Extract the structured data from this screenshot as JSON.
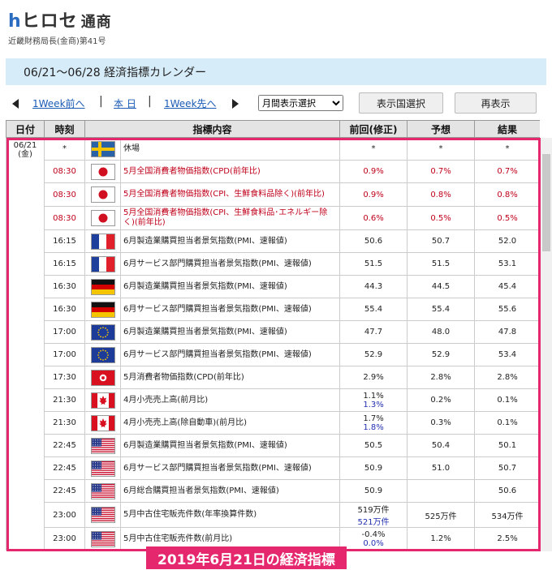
{
  "logo": {
    "brand_h": "h",
    "brand_rest": "ヒロセ",
    "brand_sub": "通商",
    "registration": "近畿財務局長(金商)第41号"
  },
  "title": "06/21～06/28 経済指標カレンダー",
  "nav": {
    "prev_week": "1Week前へ",
    "today": "本 日",
    "next_week": "1Week先へ",
    "view_select": "月間表示選択",
    "country_button": "表示国選択",
    "refresh_button": "再表示"
  },
  "table": {
    "headers": {
      "date": "日付",
      "time": "時刻",
      "content": "指標内容",
      "previous": "前回(修正)",
      "forecast": "予想",
      "result": "結果"
    },
    "date_label": "06/21\n(金)",
    "rows": [
      {
        "time": "*",
        "flag": "sweden",
        "name": "休場",
        "prev": "*",
        "prev_rev": "",
        "forecast": "*",
        "result": "*",
        "red": false
      },
      {
        "time": "08:30",
        "flag": "japan",
        "name": "5月全国消費者物価指数(CPD(前年比)",
        "prev": "0.9%",
        "prev_rev": "",
        "forecast": "0.7%",
        "result": "0.7%",
        "red": true
      },
      {
        "time": "08:30",
        "flag": "japan",
        "name": "5月全国消費者物価指数(CPI、生鮮食料品除く)(前年比)",
        "prev": "0.9%",
        "prev_rev": "",
        "forecast": "0.8%",
        "result": "0.8%",
        "red": true
      },
      {
        "time": "08:30",
        "flag": "japan",
        "name": "5月全国消費者物価指数(CPI、生鮮食料品･エネルギー除く)(前年比)",
        "prev": "0.6%",
        "prev_rev": "",
        "forecast": "0.5%",
        "result": "0.5%",
        "red": true
      },
      {
        "time": "16:15",
        "flag": "france",
        "name": "6月製造業購買担当者景気指数(PMI、速報値)",
        "prev": "50.6",
        "prev_rev": "",
        "forecast": "50.7",
        "result": "52.0",
        "red": false
      },
      {
        "time": "16:15",
        "flag": "france",
        "name": "6月サービス部門購買担当者景気指数(PMI、速報値)",
        "prev": "51.5",
        "prev_rev": "",
        "forecast": "51.5",
        "result": "53.1",
        "red": false
      },
      {
        "time": "16:30",
        "flag": "germany",
        "name": "6月製造業購買担当者景気指数(PMI、速報値)",
        "prev": "44.3",
        "prev_rev": "",
        "forecast": "44.5",
        "result": "45.4",
        "red": false
      },
      {
        "time": "16:30",
        "flag": "germany",
        "name": "6月サービス部門購買担当者景気指数(PMI、速報値)",
        "prev": "55.4",
        "prev_rev": "",
        "forecast": "55.4",
        "result": "55.6",
        "red": false
      },
      {
        "time": "17:00",
        "flag": "eu",
        "name": "6月製造業購買担当者景気指数(PMI、速報値)",
        "prev": "47.7",
        "prev_rev": "",
        "forecast": "48.0",
        "result": "47.8",
        "red": false
      },
      {
        "time": "17:00",
        "flag": "eu",
        "name": "6月サービス部門購買担当者景気指数(PMI、速報値)",
        "prev": "52.9",
        "prev_rev": "",
        "forecast": "52.9",
        "result": "53.4",
        "red": false
      },
      {
        "time": "17:30",
        "flag": "hongkong",
        "name": "5月消費者物価指数(CPD(前年比)",
        "prev": "2.9%",
        "prev_rev": "",
        "forecast": "2.8%",
        "result": "2.8%",
        "red": false
      },
      {
        "time": "21:30",
        "flag": "canada",
        "name": "4月小売売上高(前月比)",
        "prev": "1.1%",
        "prev_rev": "1.3%",
        "forecast": "0.2%",
        "result": "0.1%",
        "red": false
      },
      {
        "time": "21:30",
        "flag": "canada",
        "name": "4月小売売上高(除自動車)(前月比)",
        "prev": "1.7%",
        "prev_rev": "1.8%",
        "forecast": "0.3%",
        "result": "0.1%",
        "red": false
      },
      {
        "time": "22:45",
        "flag": "usa",
        "name": "6月製造業購買担当者景気指数(PMI、速報値)",
        "prev": "50.5",
        "prev_rev": "",
        "forecast": "50.4",
        "result": "50.1",
        "red": false
      },
      {
        "time": "22:45",
        "flag": "usa",
        "name": "6月サービス部門購買担当者景気指数(PMI、速報値)",
        "prev": "50.9",
        "prev_rev": "",
        "forecast": "51.0",
        "result": "50.7",
        "red": false
      },
      {
        "time": "22:45",
        "flag": "usa",
        "name": "6月総合購買担当者景気指数(PMI、速報値)",
        "prev": "50.9",
        "prev_rev": "",
        "forecast": "",
        "result": "50.6",
        "red": false
      },
      {
        "time": "23:00",
        "flag": "usa",
        "name": "5月中古住宅販売件数(年率換算件数)",
        "prev": "519万件",
        "prev_rev": "521万件",
        "forecast": "525万件",
        "result": "534万件",
        "red": false
      },
      {
        "time": "23:00",
        "flag": "usa",
        "name": "5月中古住宅販売件数(前月比)",
        "prev": "-0.4%",
        "prev_rev": "0.0%",
        "forecast": "1.2%",
        "result": "2.5%",
        "red": false
      }
    ]
  },
  "caption": "2019年6月21日の経済指標",
  "colors": {
    "highlight": "#e5286e",
    "title_bg": "#d7ecf9",
    "red_text": "#c0001a",
    "link": "#1a5bb5"
  }
}
